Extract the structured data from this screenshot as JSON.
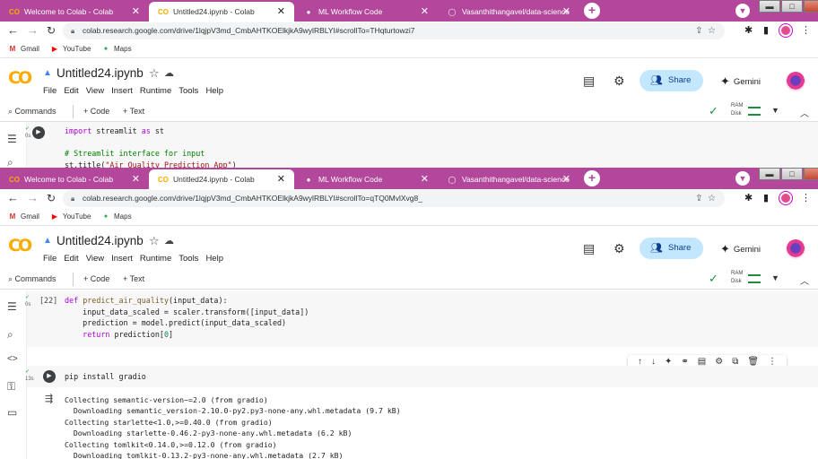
{
  "browser": {
    "tabs": [
      {
        "label": "Welcome to Colab - Colab",
        "icon": "CO"
      },
      {
        "label": "Untitled24.ipynb - Colab",
        "icon": "CO"
      },
      {
        "label": "ML Workflow Code",
        "icon": "●"
      },
      {
        "label": "Vasanthithangavel/data-science",
        "icon": "◯"
      }
    ],
    "tab_close": "✕",
    "new_tab": "+",
    "url_top": "colab.research.google.com/drive/1lqjpV3md_CmbAHTKOElkjkA9wylRBLYI#scrollTo=THqturtowzi7",
    "url_bottom": "colab.research.google.com/drive/1lqjpV3md_CmbAHTKOElkjkA9wylRBLYI#scrollTo=qTQ0MvlXvg8_",
    "bookmarks": [
      {
        "label": "Gmail",
        "icon": "M",
        "color": "#d93025"
      },
      {
        "label": "YouTube",
        "icon": "▶",
        "color": "#ff0000"
      },
      {
        "label": "Maps",
        "icon": "✦",
        "color": "#34a853"
      }
    ]
  },
  "colab": {
    "logo": "CO",
    "title": "Untitled24.ipynb",
    "menu": [
      "File",
      "Edit",
      "View",
      "Insert",
      "Runtime",
      "Tools",
      "Help"
    ],
    "share_label": "Share",
    "gemini_label": "Gemini",
    "toolbar": {
      "commands": "Commands",
      "add_code": "+ Code",
      "add_text": "+ Text",
      "ram": "RAM",
      "disk": "Disk"
    }
  },
  "top_cell": {
    "lines": [
      "import streamlit as st",
      "",
      "# Streamlit interface for input",
      "st.title(\"Air Quality Prediction App\")"
    ],
    "status": "0s"
  },
  "cell_predict": {
    "exec_count": "[22]",
    "status": "0s",
    "lines": [
      "def predict_air_quality(input_data):",
      "    input_data_scaled = scaler.transform([input_data])",
      "    prediction = model.predict(input_data_scaled)",
      "    return prediction[0]"
    ]
  },
  "cell_pip": {
    "status": "13s",
    "code": "pip install gradio",
    "output": [
      "Collecting semantic-version~=2.0 (from gradio)",
      "  Downloading semantic_version-2.10.0-py2.py3-none-any.whl.metadata (9.7 kB)",
      "Collecting starlette<1.0,>=0.40.0 (from gradio)",
      "  Downloading starlette-0.46.2-py3-none-any.whl.metadata (6.2 kB)",
      "Collecting tomlkit<0.14.0,>=0.12.0 (from gradio)",
      "  Downloading tomlkit-0.13.2-py3-none-any.whl.metadata (2.7 kB)"
    ]
  },
  "colors": {
    "tabstrip": "#b3479b",
    "share_bg": "#c2e7ff",
    "colab_orange": "#f9ab00"
  }
}
